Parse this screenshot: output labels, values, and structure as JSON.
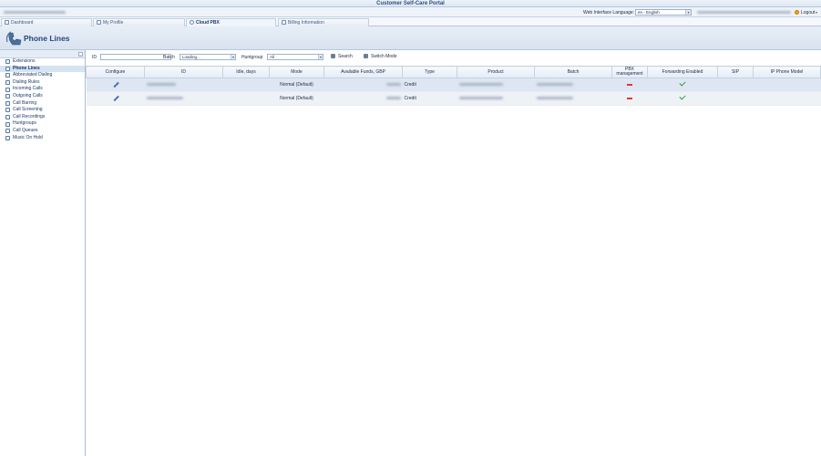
{
  "app": {
    "title": "Customer Self-Care Portal"
  },
  "header": {
    "account_info_blurred": "Available Funds: 100.00 GBP",
    "language_label": "Web Interface Language:",
    "language_value": "en - English",
    "user_blurred": "Username / Role",
    "logout_label": "Logout"
  },
  "tabs": [
    {
      "label": "Dashboard",
      "icon": "dashboard-icon"
    },
    {
      "label": "My Profile",
      "icon": "user-icon"
    },
    {
      "label": "Cloud PBX",
      "icon": "cloud-icon"
    },
    {
      "label": "Billing Information",
      "icon": "billing-icon"
    }
  ],
  "page": {
    "title": "Phone Lines",
    "icon": "phone-lines-icon"
  },
  "sidebar": {
    "items": [
      {
        "label": "Extensions",
        "icon": "extensions-icon"
      },
      {
        "label": "Phone Lines",
        "icon": "phone-lines-icon",
        "active": true
      },
      {
        "label": "Abbreviated Dialing",
        "icon": "abbreviated-dialing-icon"
      },
      {
        "label": "Dialing Rules",
        "icon": "dialing-rules-icon"
      },
      {
        "label": "Incoming Calls",
        "icon": "incoming-calls-icon"
      },
      {
        "label": "Outgoing Calls",
        "icon": "outgoing-calls-icon"
      },
      {
        "label": "Call Barring",
        "icon": "call-barring-icon"
      },
      {
        "label": "Call Screening",
        "icon": "call-screening-icon"
      },
      {
        "label": "Call Recordings",
        "icon": "call-recordings-icon"
      },
      {
        "label": "Huntgroups",
        "icon": "huntgroups-icon"
      },
      {
        "label": "Call Queues",
        "icon": "call-queues-icon"
      },
      {
        "label": "Music On Hold",
        "icon": "music-on-hold-icon"
      }
    ]
  },
  "filters": {
    "id_label": "ID",
    "id_value": "",
    "batch_label": "Batch",
    "batch_value": "Loading...",
    "huntgroup_label": "Huntgroup",
    "huntgroup_value": "All",
    "search_label": "Search",
    "switch_mode_label": "Switch Mode"
  },
  "table": {
    "columns": [
      "Configure",
      "ID",
      "Idle, days",
      "Mode",
      "Available Funds, GBP",
      "Type",
      "Product",
      "Batch",
      "PBX management",
      "Forwarding Enabled",
      "SIP",
      "IP Phone Model"
    ],
    "rows": [
      {
        "id": "",
        "idle": "",
        "mode": "Normal (Default)",
        "funds": "",
        "type": "Credit",
        "product": "",
        "batch": "",
        "pbx": "disabled",
        "forwarding": "enabled",
        "sip": "",
        "ip_model": ""
      },
      {
        "id": "",
        "idle": "",
        "mode": "Normal (Default)",
        "funds": "",
        "type": "Credit",
        "product": "",
        "batch": "",
        "pbx": "disabled",
        "forwarding": "enabled",
        "sip": "",
        "ip_model": ""
      }
    ]
  },
  "colors": {
    "accent": "#25477a",
    "pbx_disabled": "#e0392b",
    "forwarding_enabled": "#2e9a3a",
    "row_selected": "#dde6f2"
  }
}
